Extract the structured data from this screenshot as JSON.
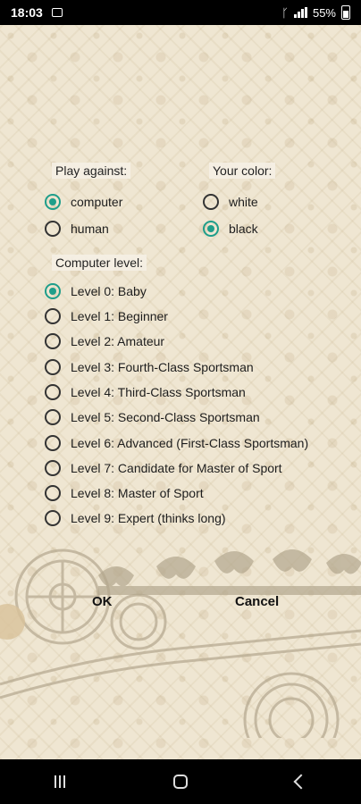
{
  "status": {
    "time": "18:03",
    "battery": "55%"
  },
  "play_against": {
    "label": "Play against:",
    "options": [
      {
        "label": "computer",
        "checked": true
      },
      {
        "label": "human",
        "checked": false
      }
    ]
  },
  "your_color": {
    "label": "Your color:",
    "options": [
      {
        "label": "white",
        "checked": false
      },
      {
        "label": "black",
        "checked": true
      }
    ]
  },
  "computer_level": {
    "label": "Computer level:",
    "options": [
      {
        "label": "Level 0: Baby",
        "checked": true
      },
      {
        "label": "Level 1: Beginner",
        "checked": false
      },
      {
        "label": "Level 2: Amateur",
        "checked": false
      },
      {
        "label": "Level 3: Fourth-Class Sportsman",
        "checked": false
      },
      {
        "label": "Level 4: Third-Class Sportsman",
        "checked": false
      },
      {
        "label": "Level 5: Second-Class Sportsman",
        "checked": false
      },
      {
        "label": "Level 6: Advanced (First-Class Sportsman)",
        "checked": false
      },
      {
        "label": "Level 7: Candidate for Master of Sport",
        "checked": false
      },
      {
        "label": "Level 8: Master of Sport",
        "checked": false
      },
      {
        "label": "Level 9: Expert (thinks long)",
        "checked": false
      }
    ]
  },
  "buttons": {
    "ok": "OK",
    "cancel": "Cancel"
  },
  "colors": {
    "accent": "#1f9e8a",
    "background": "#efe6d2",
    "text": "#1d1d1d"
  }
}
